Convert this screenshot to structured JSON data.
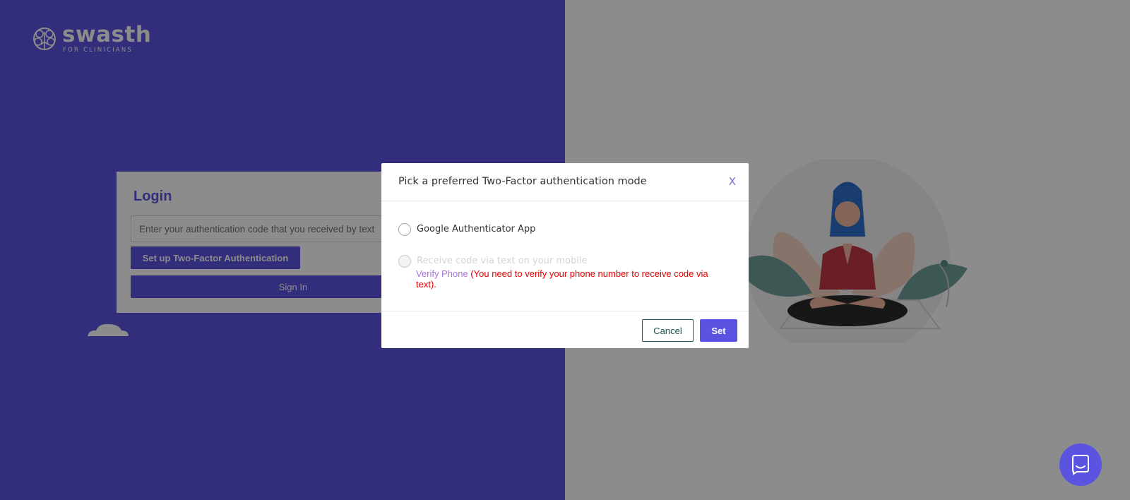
{
  "logo": {
    "name": "swasth",
    "subtitle": "FOR CLINICIANS"
  },
  "login": {
    "title": "Login",
    "input_placeholder": "Enter your authentication code that you received by text",
    "setup_button": "Set up Two-Factor Authentication",
    "signin_button": "Sign In"
  },
  "modal": {
    "title": "Pick a preferred Two-Factor authentication mode",
    "close_label": "X",
    "options": [
      {
        "label": "Google Authenticator App",
        "disabled": false
      },
      {
        "label": "Receive code via text on your mobile",
        "disabled": true
      }
    ],
    "verify_link": "Verify Phone",
    "verify_note": "(You need to verify your phone number to receive code via text).",
    "cancel_button": "Cancel",
    "set_button": "Set"
  },
  "colors": {
    "brand_primary": "#5b54e0",
    "error_text": "#e00000",
    "link": "#a972d8"
  },
  "icons": {
    "logo": "swasth-brain-tree-icon",
    "close": "close-icon",
    "chat": "chat-icon"
  }
}
